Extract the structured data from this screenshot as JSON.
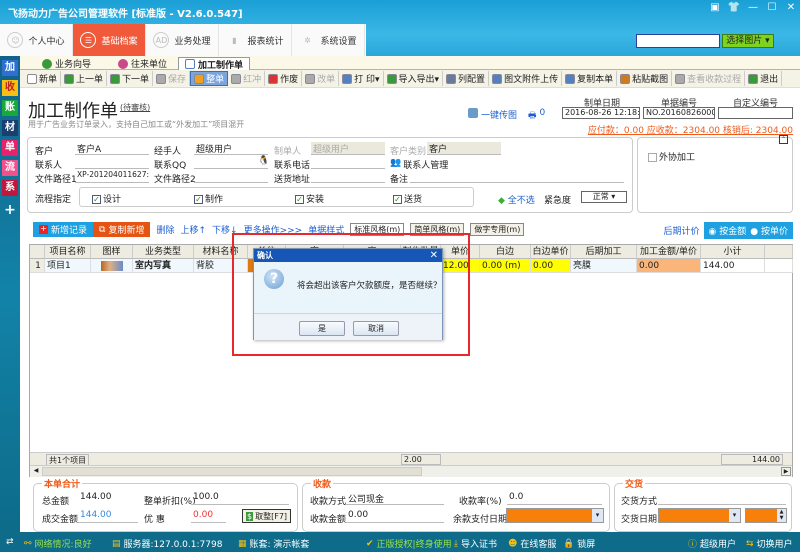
{
  "window": {
    "title": "飞扬动力广告公司管理软件 [标准版 - V2.6.0.547]",
    "controls": [
      "▣",
      "👕",
      "—",
      "☐",
      "✕"
    ]
  },
  "nav": [
    {
      "label": "个人中心",
      "icon": "user-icon",
      "glyph": "☺"
    },
    {
      "label": "基础档案",
      "icon": "list-icon",
      "glyph": "☰",
      "active": true
    },
    {
      "label": "业务处理",
      "icon": "ad-icon",
      "glyph": "AD"
    },
    {
      "label": "报表统计",
      "icon": "bar-chart-icon",
      "glyph": "▮"
    },
    {
      "label": "系统设置",
      "icon": "gear-icon",
      "glyph": "✲"
    }
  ],
  "search": {
    "value": "",
    "button": "选择图片",
    "arrow": "▾"
  },
  "sidebar": [
    {
      "label": "加",
      "color": "#2e6fd0"
    },
    {
      "label": "收",
      "color": "#f5c012"
    },
    {
      "label": "账",
      "color": "#18a93a"
    },
    {
      "label": "材",
      "color": "#1d3f6e"
    },
    {
      "label": "单",
      "color": "#e8226a"
    },
    {
      "label": "流",
      "color": "#f0508c"
    },
    {
      "label": "系",
      "color": "#c0183c"
    },
    {
      "label": "+",
      "color": "transparent"
    }
  ],
  "doc_tabs": [
    "业务向导",
    "往来单位",
    "加工制作单"
  ],
  "toolbar": [
    {
      "label": "新单"
    },
    {
      "label": "上一单"
    },
    {
      "label": "下一单"
    },
    {
      "label": "保存",
      "disabled": true
    },
    {
      "label": "整单",
      "selected": true
    },
    {
      "label": "红冲",
      "disabled": true
    },
    {
      "label": "作废"
    },
    {
      "label": "改单",
      "disabled": true
    },
    {
      "label": "打 印▾"
    },
    {
      "label": "导入导出▾"
    },
    {
      "label": "列配置"
    },
    {
      "label": "图文附件上传"
    },
    {
      "label": "复制本单"
    },
    {
      "label": "粘贴截图"
    },
    {
      "label": "查看收款过程",
      "disabled": true
    },
    {
      "label": "退出"
    }
  ],
  "page": {
    "title": "加工制作单",
    "status": "(待審核)",
    "subtitle": "用于广告业务订单录入，支持自己加工或“外发加工”项目混开",
    "upload": "一键传图",
    "print_count": "0"
  },
  "header_fields": {
    "date_label": "制单日期",
    "date": "2016-08-26 12:18:21",
    "no_label": "单据编号",
    "no": "NO.201608260006",
    "custom_label": "自定义编号",
    "custom": "",
    "balance": "应付款：0.00 应收款：2304.00  核销后: 2304.00"
  },
  "form": {
    "customer_label": "客户",
    "customer": "客户A",
    "handler_label": "经手人",
    "handler": "超级用户",
    "maker_label": "制单人",
    "maker": "超级用户",
    "ctype_label": "客户类别",
    "ctype": "客户",
    "contact_label": "联系人",
    "contact": "",
    "qq_label": "联系QQ",
    "qq": "",
    "phone_label": "联系电话",
    "phone": "",
    "contact_mgr": "联系人管理",
    "path1_label": "文件路径1",
    "path1": "XP-201204011627:C:\\",
    "path2_label": "文件路径2",
    "path2": "",
    "address_label": "送货地址",
    "address": "",
    "remark_label": "备注",
    "remark": "",
    "flow_label": "流程指定",
    "flows": [
      "设计",
      "制作",
      "安装",
      "送货"
    ],
    "none": "全不选",
    "urgency_label": "紧急度",
    "urgency": "正常",
    "outsource": "外协加工"
  },
  "grid_toolbar": {
    "add": "新增记录",
    "copy": "复制新增",
    "delete": "删除",
    "up": "上移↑",
    "down": "下移↓",
    "more": "更多操作>>>",
    "style_label": "单据样式",
    "styles": [
      "标准风格(m)",
      "简单风格(m)",
      "做字专用(m)"
    ],
    "price_label": "后期计价",
    "mode_amount": "按金额",
    "mode_unit": "按单价"
  },
  "grid": {
    "columns": [
      "",
      "项目名称",
      "图样",
      "业务类型",
      "材料名称",
      "单位",
      "宽",
      "高",
      "制作数量",
      "单价",
      "白边",
      "白边单价",
      "后期加工",
      "加工金额/单价",
      "小计",
      ""
    ],
    "rows": [
      [
        "1",
        "项目1",
        "",
        "室内写真",
        "背胶",
        "",
        "",
        "",
        "",
        "12.00",
        "0.00 (m)",
        "0.00",
        "亮膜",
        "0.00",
        "144.00",
        ""
      ]
    ],
    "footer_count": "共1个项目",
    "footer_qty": "2.00",
    "footer_total": "144.00"
  },
  "totals": {
    "title": "本单合计",
    "total_label": "总金额",
    "total": "144.00",
    "discount_label": "整单折扣(%)",
    "discount": "100.0",
    "deal_label": "成交金额",
    "deal": "144.00",
    "favor_label": "优 惠",
    "favor": "0.00",
    "round_btn": "取整[F7]"
  },
  "receipt": {
    "title": "收款",
    "method_label": "收款方式",
    "method": "公司现金",
    "rate_label": "收款率(%)",
    "rate": "0.0",
    "amount_label": "收款金额",
    "amount": "0.00",
    "due_label": "余款支付日期"
  },
  "delivery": {
    "title": "交货",
    "method_label": "交货方式",
    "date_label": "交货日期"
  },
  "dialog": {
    "title": "确认",
    "message": "将会超出该客户欠款额度，是否继续？",
    "yes": "是",
    "cancel": "取消"
  },
  "status": {
    "network": "网络情况:良好",
    "server": "服务器:127.0.0.1:7798",
    "account": "账套: 演示帐套",
    "license": "正版授权|终身使用",
    "import": "导入证书",
    "service": "在线客服",
    "lock": "锁屏",
    "user": "超级用户",
    "switch": "切换用户"
  }
}
